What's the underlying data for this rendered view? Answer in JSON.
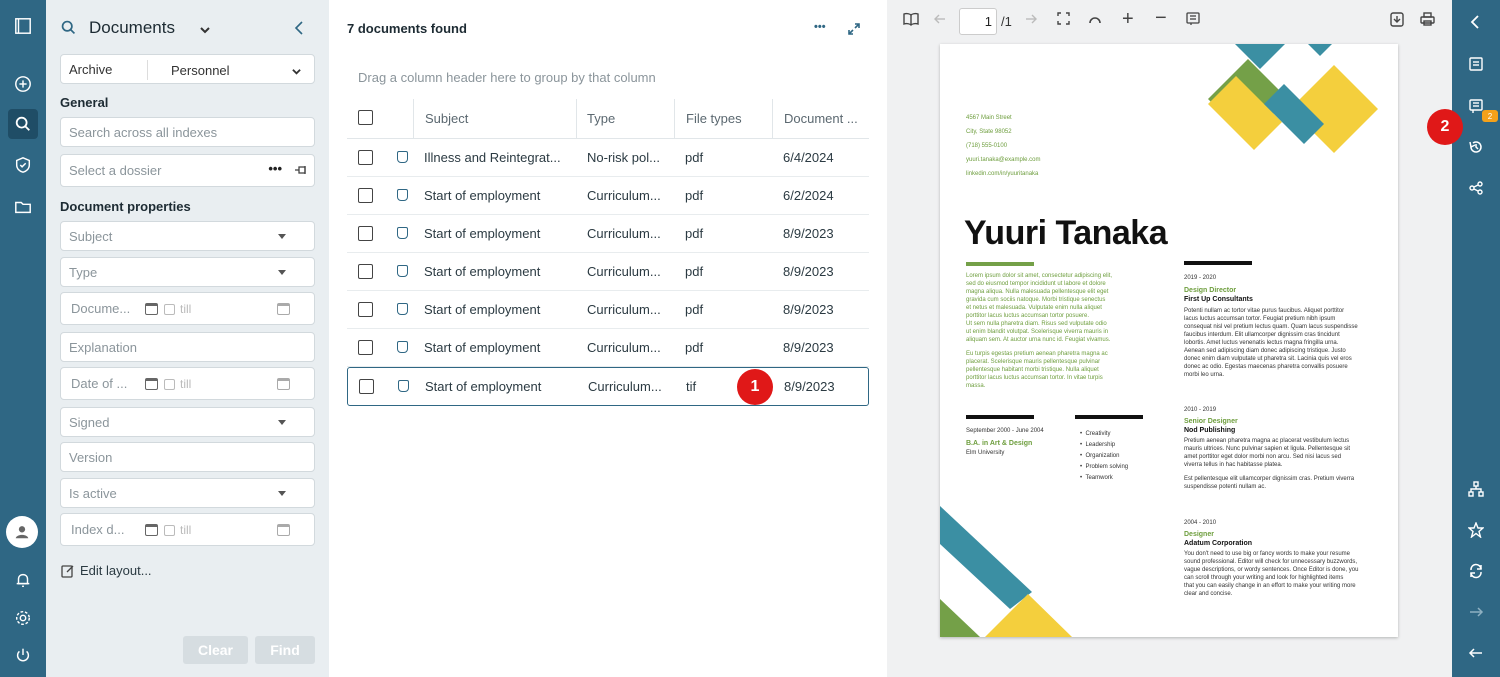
{
  "search_panel": {
    "title": "Documents",
    "archive_label": "Archive",
    "archive_value": "Personnel",
    "general_heading": "General",
    "search_placeholder": "Search across all indexes",
    "dossier_placeholder": "Select a dossier",
    "properties_heading": "Document properties",
    "fields": {
      "subject": "Subject",
      "type": "Type",
      "document_date": "Docume...",
      "till": "till",
      "explanation": "Explanation",
      "date_of": "Date of ...",
      "signed": "Signed",
      "version": "Version",
      "is_active": "Is active",
      "index_date": "Index d..."
    },
    "edit_layout": "Edit layout...",
    "clear_button": "Clear",
    "find_button": "Find"
  },
  "list": {
    "found": "7 documents found",
    "group_hint": "Drag a column header here to group by that column",
    "columns": [
      "Subject",
      "Type",
      "File types",
      "Document ..."
    ],
    "rows": [
      {
        "subject": "Illness and Reintegrat...",
        "type": "No-risk pol...",
        "file": "pdf",
        "date": "6/4/2024"
      },
      {
        "subject": "Start of employment",
        "type": "Curriculum...",
        "file": "pdf",
        "date": "6/2/2024"
      },
      {
        "subject": "Start of employment",
        "type": "Curriculum...",
        "file": "pdf",
        "date": "8/9/2023"
      },
      {
        "subject": "Start of employment",
        "type": "Curriculum...",
        "file": "pdf",
        "date": "8/9/2023"
      },
      {
        "subject": "Start of employment",
        "type": "Curriculum...",
        "file": "pdf",
        "date": "8/9/2023"
      },
      {
        "subject": "Start of employment",
        "type": "Curriculum...",
        "file": "pdf",
        "date": "8/9/2023"
      },
      {
        "subject": "Start of employment",
        "type": "Curriculum...",
        "file": "tif",
        "date": "8/9/2023"
      }
    ],
    "marker": "1"
  },
  "viewer": {
    "page_current": "1",
    "page_total": "/1",
    "marker": "2",
    "notif_count": "2",
    "resume": {
      "contact": [
        "4567 Main Street",
        "City, State 98052",
        "(718) 555-0100",
        "yuuri.tanaka@example.com",
        "linkedin.com/in/yuuritanaka"
      ],
      "name": "Yuuri Tanaka",
      "summary": [
        "Lorem ipsum dolor sit amet, consectetur adipiscing elit,",
        "sed do eiusmod tempor incididunt ut labore et dolore",
        "magna aliqua. Nulla malesuada pellentesque elit eget",
        "gravida cum sociis natoque. Morbi tristique senectus",
        "et netus et malesuada. Vulputate enim nulla aliquet",
        "porttitor lacus luctus accumsan tortor posuere.",
        "Ut sem nulla pharetra diam. Risus sed vulputate odio",
        "ut enim blandit volutpat. Scelerisque viverra mauris in",
        "aliquam sem. At auctor urna nunc id. Feugiat vivamus.",
        "",
        "Eu turpis egestas pretium aenean pharetra magna ac",
        "placerat. Scelerisque mauris pellentesque pulvinar",
        "pellentesque habitant morbi tristique. Nulla aliquet",
        "porttitor lacus luctus accumsan tortor. In vitae turpis",
        "massa."
      ],
      "edu_date": "September 2000 - June 2004",
      "edu_degree": "B.A. in Art & Design",
      "edu_school": "Elm University",
      "skills": [
        "Creativity",
        "Leadership",
        "Organization",
        "Problem solving",
        "Teamwork"
      ],
      "jobs": [
        {
          "years": "2019 - 2020",
          "title": "Design Director",
          "company": "First Up Consultants",
          "text": [
            "Potenti nullam ac tortor vitae purus faucibus. Aliquet porttitor",
            "lacus luctus accumsan tortor. Feugiat pretium nibh ipsum",
            "consequat nisl vel pretium lectus quam. Quam lacus suspendisse",
            "faucibus interdum. Elit ullamcorper dignissim cras tincidunt",
            "lobortis. Amet luctus venenatis lectus magna fringilla urna.",
            "Aenean sed adipiscing diam donec adipiscing tristique. Justo",
            "donec enim diam vulputate ut pharetra sit. Lacinia quis vel eros",
            "donec ac odio. Egestas maecenas pharetra convallis posuere",
            "morbi leo urna."
          ]
        },
        {
          "years": "2010 - 2019",
          "title": "Senior Designer",
          "company": "Nod Publishing",
          "text": [
            "Pretium aenean pharetra magna ac placerat vestibulum lectus",
            "mauris ultrices. Nunc pulvinar sapien et ligula. Pellentesque sit",
            "amet porttitor eget dolor morbi non arcu. Sed nisi lacus sed",
            "viverra tellus in hac habitasse platea.",
            "",
            "Est pellentesque elit ullamcorper dignissim cras. Pretium viverra",
            "suspendisse potenti nullam ac."
          ]
        },
        {
          "years": "2004 - 2010",
          "title": "Designer",
          "company": "Adatum Corporation",
          "text": [
            "You don't need to use big or fancy words to make your resume",
            "sound professional. Editor will check for unnecessary buzzwords,",
            "vague descriptions, or wordy sentences. Once Editor is done, you",
            "can scroll through your writing and look for highlighted items",
            "that you can easily change in an effort to make your writing more",
            "clear and concise."
          ]
        }
      ]
    }
  },
  "colors": {
    "rail": "#2f6784",
    "badge": "#e01818",
    "teal": "#3b8fa3",
    "green": "#74a048",
    "yellow": "#f4cf3d"
  }
}
